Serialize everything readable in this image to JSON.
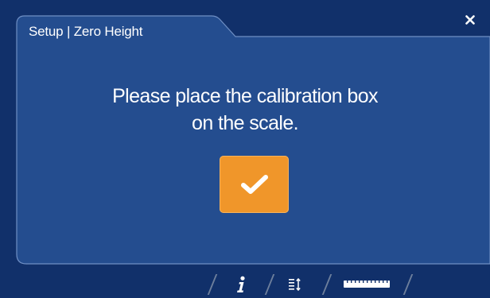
{
  "header": {
    "title": "Setup | Zero Height"
  },
  "dialog": {
    "message_line1": "Please place the calibration box",
    "message_line2": "on the scale."
  },
  "icons": {
    "close": "close-icon",
    "confirm": "checkmark-icon",
    "info": "info-icon",
    "list": "list-sort-icon",
    "ruler": "ruler-icon"
  },
  "colors": {
    "background": "#11306a",
    "panel": "#244d8f",
    "accent": "#f0962a",
    "text": "#ffffff"
  }
}
